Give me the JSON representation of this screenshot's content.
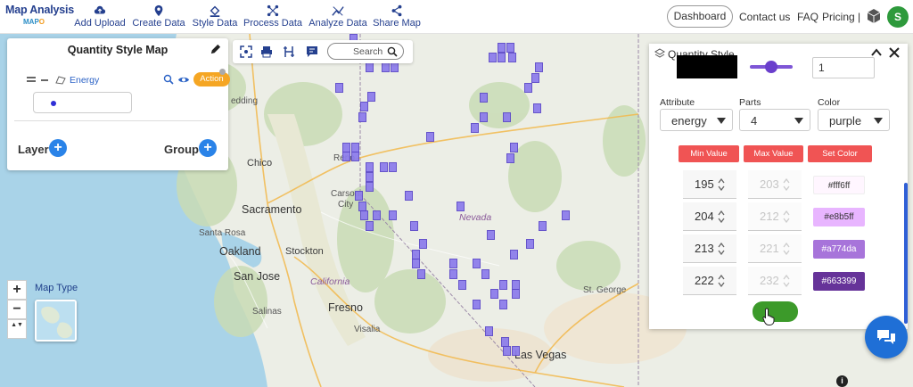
{
  "logo": {
    "title": "Map Analysis",
    "sub_prefix": "MAP",
    "sub_suffix": "O"
  },
  "nav": [
    {
      "label": "Add Upload",
      "icon": "cloud-upload-icon"
    },
    {
      "label": "Create Data",
      "icon": "map-pin-icon"
    },
    {
      "label": "Style Data",
      "icon": "paint-bucket-icon"
    },
    {
      "label": "Process Data",
      "icon": "process-icon"
    },
    {
      "label": "Analyze Data",
      "icon": "analyze-icon"
    },
    {
      "label": "Share Map",
      "icon": "share-icon"
    }
  ],
  "topright": {
    "dashboard": "Dashboard",
    "contact": "Contact us",
    "faq": "FAQ",
    "pricing": "Pricing |",
    "avatar_initial": "S"
  },
  "layer_panel": {
    "title": "Quantity Style Map",
    "layer_name": "Energy",
    "action_label": "Action",
    "layer_label": "Layer",
    "group_label": "Group",
    "plus": "+"
  },
  "toolbar": {
    "search_label": "Search"
  },
  "map_controls": {
    "zoom_in": "+",
    "zoom_out": "−",
    "reset": "▲▼",
    "map_type_label": "Map Type"
  },
  "map_labels": {
    "redding": "edding",
    "chico": "Chico",
    "reno": "Reno",
    "carson_city_1": "Carson",
    "carson_city_2": "City",
    "sacramento": "Sacramento",
    "santa_rosa": "Santa Rosa",
    "stockton": "Stockton",
    "oakland": "Oakland",
    "san_jose": "San Jose",
    "california": "California",
    "salinas": "Salinas",
    "fresno": "Fresno",
    "visalia": "Visalia",
    "nevada": "Nevada",
    "st_george": "St. George",
    "las_vegas": "Las Vegas"
  },
  "quantity_style": {
    "title": "Quantity Style",
    "stroke_width": "1",
    "attribute_label": "Attribute",
    "attribute_value": "energy",
    "parts_label": "Parts",
    "parts_value": "4",
    "color_label": "Color",
    "color_value": "purple",
    "min_value_btn": "Min Value",
    "max_value_btn": "Max Value",
    "set_color_btn": "Set Color",
    "ranges": [
      {
        "min": "195",
        "max": "203",
        "color": "#fff6ff"
      },
      {
        "min": "204",
        "max": "212",
        "color": "#e8b5ff"
      },
      {
        "min": "213",
        "max": "221",
        "color": "#a774da"
      },
      {
        "min": "222",
        "max": "232",
        "color": "#663399"
      }
    ]
  },
  "colors": {
    "brand_navy": "#25408f",
    "accent_blue": "#2a83e8",
    "action_orange": "#f5a623",
    "header_red": "#f05454",
    "apply_green": "#3c9a2a",
    "cell_purple": "#8b7bec"
  },
  "info_label": "i"
}
